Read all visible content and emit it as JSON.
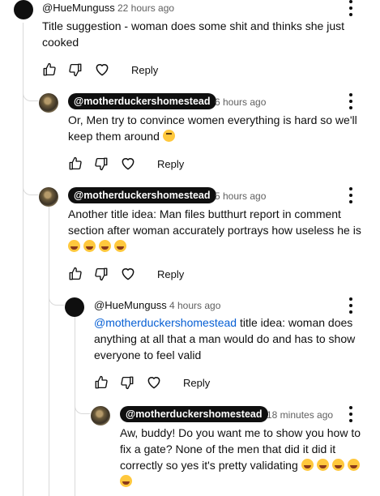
{
  "reply_label": "Reply",
  "comments": [
    {
      "author": "@HueMunguss",
      "time": "22 hours ago",
      "text": "Title suggestion - woman does some shit and thinks she just cooked"
    },
    {
      "author": "@motherduckershomestead",
      "time": "6 hours ago",
      "text": "Or, Men try to convince women everything is hard so we'll keep them around",
      "emoji": "face-with-rolling-eyes"
    },
    {
      "author": "@motherduckershomestead",
      "time": "5 hours ago",
      "text": "Another title idea: Man files butthurt report in comment section after woman accurately portrays how useless he is",
      "emoji": "face-with-tears-of-joy x4"
    },
    {
      "author": "@HueMunguss",
      "time": "4 hours ago",
      "mention": "@motherduckershomestead",
      "text": "title idea: woman does anything at all that a man would do and has to show everyone to feel valid"
    },
    {
      "author": "@motherduckershomestead",
      "time": "18 minutes ago",
      "text": "Aw, buddy! Do you want me to show you how to fix a gate? None of the men that did it did it correctly so yes it's pretty validating",
      "emoji": "face-with-tears-of-joy x5"
    }
  ]
}
